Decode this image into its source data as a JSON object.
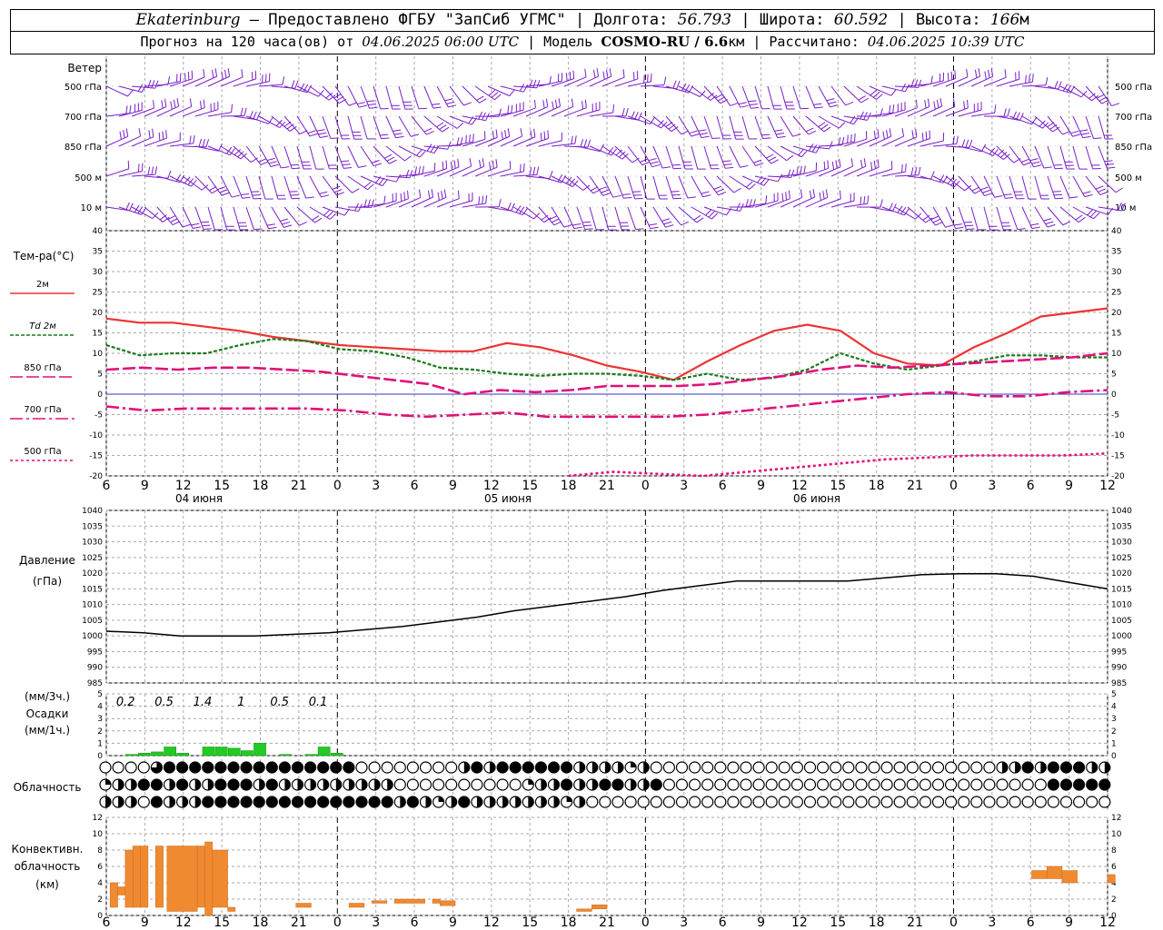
{
  "header": {
    "city": "Ekaterinburg",
    "provider": "– Предоставлено ФГБУ \"ЗапСиб УГМС\"",
    "lon_label": "Долгота:",
    "lon": "56.793",
    "lat_label": "Широта:",
    "lat": "60.592",
    "alt_label": "Высота:",
    "alt": "166",
    "alt_unit": "м",
    "forecast_prefix": "Прогноз на 120 часа(ов) от",
    "forecast_from": "04.06.2025 06:00 UTC",
    "model_label": "Модель",
    "model": "COSMO-RU / 6.6",
    "model_unit": "км",
    "calc_label": "Рассчитано:",
    "calc_time": "04.06.2025 10:39 UTC"
  },
  "time_ticks": [
    "6",
    "9",
    "12",
    "15",
    "18",
    "21",
    "0",
    "3",
    "6",
    "9",
    "12",
    "15",
    "18",
    "21",
    "0",
    "3",
    "6",
    "9",
    "12",
    "15",
    "18",
    "21",
    "0",
    "3",
    "6",
    "9",
    "12"
  ],
  "day_labels": [
    "04 июня",
    "05 июня",
    "06 июня"
  ],
  "colors": {
    "wind": "#7a1fc8",
    "t2m": "#ee3333",
    "td2m": "#1a7a1a",
    "t850": "#e0107a",
    "t700": "#e0107a",
    "t500": "#e0107a",
    "pressure": "#000000",
    "precip": "#22cc22",
    "conv": "#f08a30",
    "zero_line": "#3333cc"
  },
  "wind_panel": {
    "title": "Ветер",
    "levels": [
      "500 гПа",
      "700 гПа",
      "850 гПа",
      "500 м",
      "10  м"
    ]
  },
  "temp_panel": {
    "title": "Тем-ра(°С)",
    "legend": [
      "2м",
      "Td  2м",
      "850 гПа",
      "700 гПа",
      "500 гПа"
    ],
    "ticks": [
      "40",
      "35",
      "30",
      "25",
      "20",
      "15",
      "10",
      "5",
      "0",
      "-5",
      "-10",
      "-15",
      "-20"
    ]
  },
  "pressure_panel": {
    "title": "Давление",
    "unit": "(гПа)",
    "ticks": [
      "1040",
      "1035",
      "1030",
      "1025",
      "1020",
      "1015",
      "1010",
      "1005",
      "1000",
      "995",
      "990",
      "985"
    ]
  },
  "precip_panel": {
    "unit_3h": "(мм/3ч.)",
    "title": "Осадки",
    "unit_1h": "(мм/1ч.)",
    "ticks": [
      "5",
      "4",
      "3",
      "2",
      "1",
      "0"
    ],
    "sums": [
      "0.2",
      "0.5",
      "1.4",
      "1",
      "0.5",
      "0.1"
    ]
  },
  "cloud_panel": {
    "title": "Облачность"
  },
  "conv_panel": {
    "title_1": "Конвективн.",
    "title_2": "облачность",
    "unit": "(км)",
    "ticks": [
      "12",
      "10",
      "8",
      "6",
      "4",
      "2",
      "0"
    ]
  },
  "chart_data": [
    {
      "type": "line",
      "title": "Тем-ра(°С)",
      "x_hours": [
        0,
        3,
        6,
        9,
        12,
        15,
        18,
        21,
        24,
        27,
        30,
        33,
        36,
        39,
        42,
        45,
        48,
        51,
        54,
        57,
        60,
        63,
        66,
        69,
        72,
        75,
        78
      ],
      "ylim": [
        -20,
        40
      ],
      "series": [
        {
          "name": "2м",
          "values": [
            18.5,
            17.5,
            17.5,
            16.5,
            15.5,
            14,
            13,
            12,
            11.5,
            11,
            10.5,
            10.5,
            12.5,
            11.5,
            9.5,
            7,
            5.5,
            3.5,
            8,
            12,
            15.5,
            17,
            15.5,
            10,
            7.5,
            7,
            11.5,
            15,
            19,
            20,
            21
          ]
        },
        {
          "name": "Td 2м",
          "values": [
            12,
            9.5,
            10,
            10,
            12,
            13.5,
            13,
            11,
            10.5,
            9,
            6.5,
            6,
            5,
            4.5,
            5,
            5,
            4.5,
            3.5,
            5,
            3.5,
            4,
            6,
            10,
            7.5,
            6,
            7,
            8,
            9.5,
            9.5,
            9,
            9
          ]
        },
        {
          "name": "850 гПа",
          "values": [
            6,
            6.5,
            6,
            6.5,
            6.5,
            6,
            5.5,
            4.5,
            3.5,
            2.5,
            0,
            1,
            0.5,
            1,
            2,
            2,
            2,
            2.5,
            3.5,
            4.5,
            6,
            7,
            6.5,
            7,
            7.5,
            8,
            8.5,
            9,
            10
          ]
        },
        {
          "name": "700 гПа",
          "values": [
            -3,
            -4,
            -3.5,
            -3.5,
            -3.5,
            -3.5,
            -4,
            -5,
            -5.5,
            -5,
            -4.5,
            -5.5,
            -5.5,
            -5.5,
            -5.5,
            -5,
            -4,
            -3,
            -2,
            -1,
            0,
            0.5,
            -0.5,
            -0.5,
            0.5,
            1
          ]
        },
        {
          "name": "500 гПа",
          "values": [
            -20,
            -19,
            -19.5,
            -20,
            -19,
            -18,
            -17,
            -16,
            -15.5,
            -15,
            -15,
            -15,
            -14.5
          ]
        }
      ]
    },
    {
      "type": "line",
      "title": "Давление",
      "x_hours": [
        0,
        3,
        6,
        9,
        12,
        15,
        18,
        21,
        24,
        27,
        30,
        33,
        36,
        39,
        42,
        45,
        48,
        51,
        54,
        57,
        60,
        63,
        66,
        69,
        72,
        75,
        78
      ],
      "ylim": [
        985,
        1040
      ],
      "series": [
        {
          "name": "",
          "values": [
            1001.5,
            1001,
            1000,
            1000,
            1000,
            1000.5,
            1001,
            1002,
            1003,
            1004.5,
            1006,
            1008,
            1009.5,
            1011,
            1012.5,
            1014.5,
            1016,
            1017.5,
            1017.5,
            1017.5,
            1017.5,
            1018.5,
            1019.5,
            1019.8,
            1019.8,
            1019,
            1017,
            1015
          ]
        }
      ]
    },
    {
      "type": "bar",
      "title": "Осадки",
      "x_hours": [
        2,
        3,
        4,
        5,
        6,
        7,
        8,
        9,
        10,
        11,
        12,
        13,
        14,
        15,
        16,
        17,
        18,
        19,
        20,
        21,
        22
      ],
      "values": [
        0.1,
        0.2,
        0.3,
        0.7,
        0.2,
        0,
        0.7,
        0.7,
        0.6,
        0.4,
        1.0,
        0,
        0.1,
        0,
        0.1,
        0.7,
        0.2,
        0,
        0,
        0,
        0
      ]
    },
    {
      "type": "bar",
      "title": "Конвективн. облачность",
      "bars": [
        [
          0.5,
          1.5,
          1,
          4
        ],
        [
          1.5,
          2.5,
          2.5,
          3.5
        ],
        [
          2.5,
          3.5,
          1,
          8
        ],
        [
          3.5,
          4.5,
          1,
          8.5
        ],
        [
          4.5,
          5.5,
          1,
          8.5
        ],
        [
          6,
          7,
          2,
          2
        ],
        [
          6.5,
          7.5,
          1,
          8.5
        ],
        [
          8,
          12,
          0.5,
          8.5
        ],
        [
          12,
          13,
          1,
          8.5
        ],
        [
          13,
          14,
          0,
          9
        ],
        [
          14,
          16,
          1,
          8
        ],
        [
          16,
          17,
          0.5,
          1
        ],
        [
          25,
          27,
          1,
          1.5
        ],
        [
          32,
          34,
          1,
          1.5
        ],
        [
          35,
          37,
          1.5,
          1.8
        ],
        [
          38,
          42,
          1.5,
          2
        ],
        [
          43,
          44,
          1.5,
          2
        ],
        [
          44,
          46,
          1.2,
          1.8
        ],
        [
          62,
          64,
          0.5,
          0.8
        ],
        [
          64,
          66,
          0.8,
          1.3
        ],
        [
          122,
          124,
          4.5,
          5.5
        ],
        [
          124,
          126,
          4.5,
          6
        ],
        [
          126,
          128,
          4,
          5.5
        ],
        [
          132,
          133,
          4,
          5
        ]
      ]
    }
  ]
}
